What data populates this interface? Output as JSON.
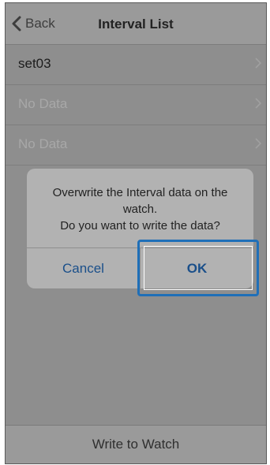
{
  "navbar": {
    "back_label": "Back",
    "title": "Interval List"
  },
  "list": {
    "rows": [
      {
        "label": "set03",
        "state": "active"
      },
      {
        "label": "No Data",
        "state": "empty"
      },
      {
        "label": "No Data",
        "state": "empty"
      }
    ]
  },
  "dialog": {
    "message_lines": [
      "Overwrite the Interval data on the",
      "watch.",
      "Do you want to write the data?"
    ],
    "cancel_label": "Cancel",
    "ok_label": "OK"
  },
  "bottom_bar": {
    "label": "Write to Watch"
  },
  "colors": {
    "highlight": "#1f6fb8",
    "dialog_button_text": "#1a4f8a"
  }
}
